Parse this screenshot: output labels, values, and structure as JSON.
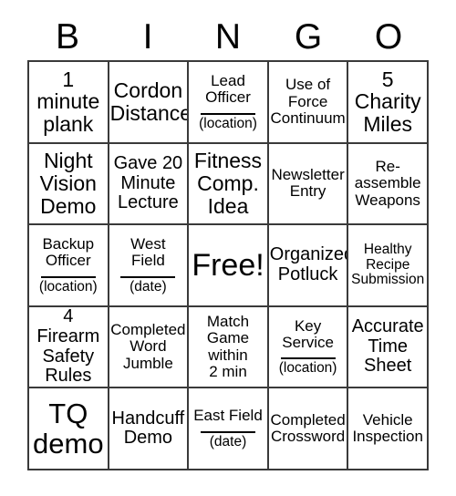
{
  "header": {
    "letters": [
      "B",
      "I",
      "N",
      "G",
      "O"
    ]
  },
  "colors": {
    "border": "#3a3a3a",
    "text": "#000000",
    "background": "#ffffff"
  },
  "grid": {
    "rows": 5,
    "columns": 5,
    "cells": [
      {
        "text": "1\nminute\nplank",
        "size": "sz-lg",
        "blank": null
      },
      {
        "text": "Cordon\nDistance",
        "size": "sz-lg",
        "blank": null
      },
      {
        "text": "Lead\nOfficer",
        "size": "sz-sm",
        "blank": "(location)"
      },
      {
        "text": "Use of\nForce\nContinuum",
        "size": "sz-sm",
        "blank": null
      },
      {
        "text": "5\nCharity\nMiles",
        "size": "sz-lg",
        "blank": null
      },
      {
        "text": "Night\nVision\nDemo",
        "size": "sz-lg",
        "blank": null
      },
      {
        "text": "Gave 20\nMinute\nLecture",
        "size": "sz-md",
        "blank": null
      },
      {
        "text": "Fitness\nComp.\nIdea",
        "size": "sz-lg",
        "blank": null
      },
      {
        "text": "Newsletter\nEntry",
        "size": "sz-sm",
        "blank": null
      },
      {
        "text": "Re-\nassemble\nWeapons",
        "size": "sz-sm",
        "blank": null
      },
      {
        "text": "Backup\nOfficer",
        "size": "sz-sm",
        "blank": "(location)"
      },
      {
        "text": "West\nField",
        "size": "sz-sm",
        "blank": "(date)"
      },
      {
        "text": "Free!",
        "size": "sz-free",
        "blank": null
      },
      {
        "text": "Organized\nPotluck",
        "size": "sz-md",
        "blank": null
      },
      {
        "text": "Healthy\nRecipe\nSubmission",
        "size": "sz-xs",
        "blank": null
      },
      {
        "text": "4 Firearm\nSafety\nRules",
        "size": "sz-md",
        "blank": null
      },
      {
        "text": "Completed\nWord\nJumble",
        "size": "sz-sm",
        "blank": null
      },
      {
        "text": "Match\nGame\nwithin\n2 min",
        "size": "sz-sm",
        "blank": null
      },
      {
        "text": "Key\nService",
        "size": "sz-sm",
        "blank": "(location)"
      },
      {
        "text": "Accurate\nTime\nSheet",
        "size": "sz-md",
        "blank": null
      },
      {
        "text": "TQ\ndemo",
        "size": "sz-xl",
        "blank": null
      },
      {
        "text": "Handcuff\nDemo",
        "size": "sz-md",
        "blank": null
      },
      {
        "text": "East Field",
        "size": "sz-sm",
        "blank": "(date)"
      },
      {
        "text": "Completed\nCrossword",
        "size": "sz-sm",
        "blank": null
      },
      {
        "text": "Vehicle\nInspection",
        "size": "sz-sm",
        "blank": null
      }
    ]
  }
}
